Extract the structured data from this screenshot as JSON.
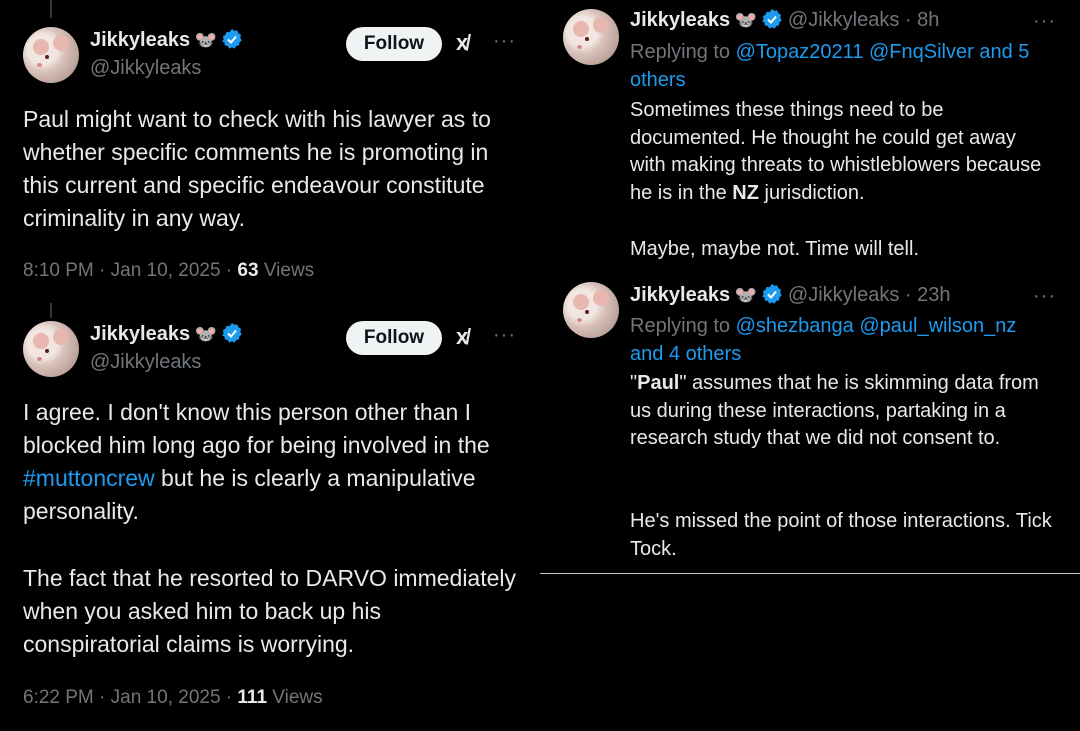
{
  "left": {
    "tweets": [
      {
        "name": "Jikkyleaks",
        "emoji": "🐭",
        "handle": "@Jikkyleaks",
        "follow_label": "Follow",
        "grok_label": "x̸",
        "more": "···",
        "body": "Paul might want to check with his lawyer as to whether specific comments he is promoting in this current and specific endeavour constitute criminality in any way.",
        "time": "8:10 PM · Jan 10, 2025 · ",
        "views_count": "63",
        "views_label": " Views"
      },
      {
        "name": "Jikkyleaks",
        "emoji": "🐭",
        "handle": "@Jikkyleaks",
        "follow_label": "Follow",
        "grok_label": "x̸",
        "more": "···",
        "body_part1": "I agree. I don't know this person other than I blocked him long ago for being involved in the ",
        "hashtag": "#muttoncrew",
        "body_part2": " but he is clearly a manipulative personality.",
        "body_para2": "The fact that he resorted to DARVO immediately when you asked him to back up his conspiratorial claims is worrying.",
        "time": "6:22 PM · Jan 10, 2025 · ",
        "views_count": "111",
        "views_label": " Views"
      }
    ]
  },
  "right": {
    "replies": [
      {
        "name": "Jikkyleaks",
        "emoji": "🐭",
        "handle_time": "@Jikkyleaks · 8h",
        "more": "···",
        "replying_prefix": "Replying to ",
        "replying_to": "@Topaz20211 @FnqSilver and 5 others",
        "body_part1": "Sometimes these things need to be documented. He thought he could get away with making threats to whistleblowers because he is in the ",
        "bold": "NZ",
        "body_part2": " jurisdiction.",
        "body_para2": "Maybe, maybe not. Time will tell."
      },
      {
        "name": "Jikkyleaks",
        "emoji": "🐭",
        "handle_time": "@Jikkyleaks · 23h",
        "more": "···",
        "replying_prefix": "Replying to ",
        "replying_to": "@shezbanga @paul_wilson_nz and 4 others",
        "quote_open": "\"",
        "bold": "Paul",
        "body_part1": "\" assumes that he is skimming data from us during these interactions, partaking in a research study that we did not consent to.",
        "body_para2": "He's missed the point of those interactions. Tick Tock."
      }
    ]
  },
  "colors": {
    "background": "#000000",
    "text": "#e7e9ea",
    "muted": "#71767b",
    "link": "#1d9bf0",
    "follow_bg": "#eff3f4"
  }
}
